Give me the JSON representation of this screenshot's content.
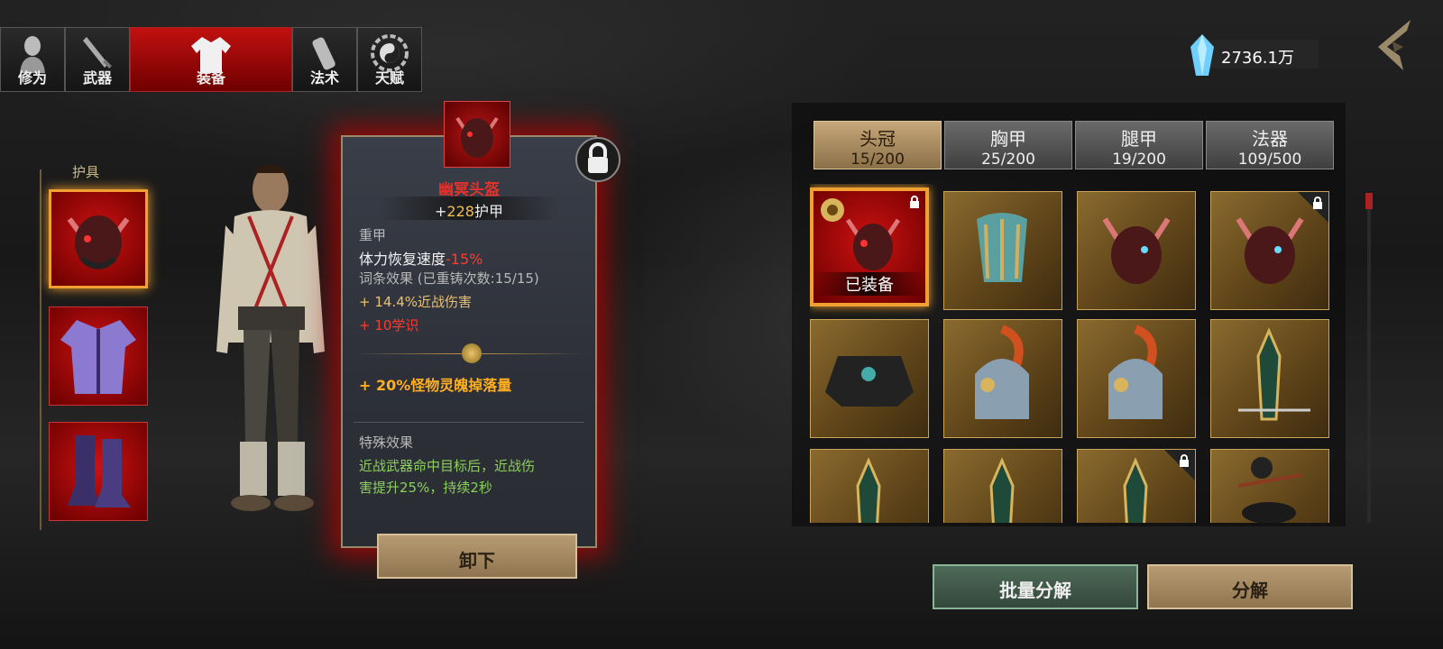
{
  "tabs": [
    {
      "label": "修为",
      "icon": "cultivation-figure-icon"
    },
    {
      "label": "武器",
      "icon": "sword-icon"
    },
    {
      "label": "装备",
      "icon": "robe-icon"
    },
    {
      "label": "法术",
      "icon": "scroll-icon"
    },
    {
      "label": "天赋",
      "icon": "bagua-icon"
    }
  ],
  "currency": {
    "value": "2736.1万",
    "icon": "crystal-icon"
  },
  "armor_slots": {
    "title": "护具"
  },
  "item": {
    "name": "幽冥头盔",
    "armor_prefix": "+",
    "armor_value": "228",
    "armor_unit": "护甲",
    "type": "重甲",
    "stamina_label": "体力恢复速度",
    "stamina_value": "-15%",
    "affix_title": "词条效果",
    "affix_recast": "(已重铸次数:15/15)",
    "affix_1": "+ 14.4%近战伤害",
    "affix_2": "+ 10学识",
    "set_bonus": "+ 20%怪物灵魄掉落量",
    "special_title": "特殊效果",
    "special_line1": "近战武器命中目标后，近战伤",
    "special_line2": "害提升25%，持续2秒",
    "unequip_label": "卸下"
  },
  "categories": [
    {
      "name": "头冠",
      "count": "15/200"
    },
    {
      "name": "胸甲",
      "count": "25/200"
    },
    {
      "name": "腿甲",
      "count": "19/200"
    },
    {
      "name": "法器",
      "count": "109/500"
    }
  ],
  "inventory": {
    "equipped_label": "已装备"
  },
  "actions": {
    "batch_label": "批量分解",
    "decompose_label": "分解"
  },
  "colors": {
    "accent_red": "#c21010",
    "gold": "#f3a033",
    "stat_red": "#ff3b30",
    "effect_green": "#8ad05a"
  }
}
